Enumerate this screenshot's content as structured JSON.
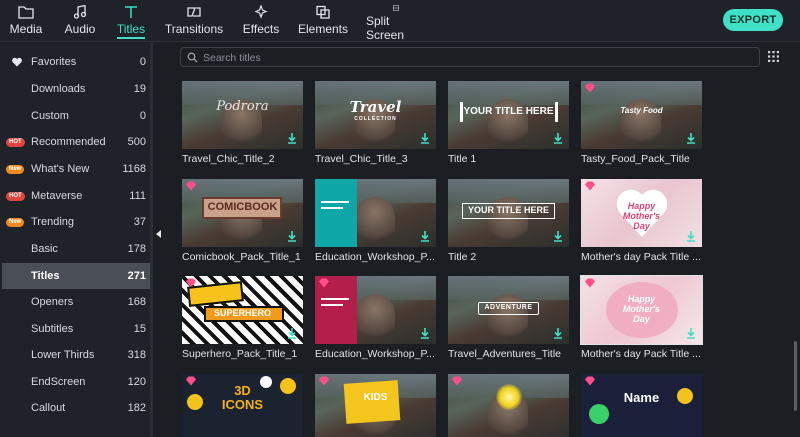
{
  "toolbar": {
    "tabs": [
      {
        "label": "Media",
        "icon": "folder-icon"
      },
      {
        "label": "Audio",
        "icon": "music-note-icon"
      },
      {
        "label": "Titles",
        "icon": "text-t-icon",
        "active": true
      },
      {
        "label": "Transitions",
        "icon": "transition-icon"
      },
      {
        "label": "Effects",
        "icon": "effects-sparkle-icon"
      },
      {
        "label": "Elements",
        "icon": "elements-icon"
      },
      {
        "label": "Split Screen",
        "icon": "split-screen-icon"
      }
    ],
    "export_label": "EXPORT"
  },
  "sidebar": {
    "items": [
      {
        "name": "Favorites",
        "count": "0",
        "icon": "heart-icon"
      },
      {
        "name": "Downloads",
        "count": "19"
      },
      {
        "name": "Custom",
        "count": "0"
      },
      {
        "name": "Recommended",
        "count": "500",
        "badge": "HOT"
      },
      {
        "name": "What's New",
        "count": "1168",
        "badge": "New"
      },
      {
        "name": "Metaverse",
        "count": "111",
        "badge": "HOT"
      },
      {
        "name": "Trending",
        "count": "37",
        "badge": "New"
      },
      {
        "name": "Basic",
        "count": "178"
      },
      {
        "name": "Titles",
        "count": "271",
        "active": true
      },
      {
        "name": "Openers",
        "count": "168"
      },
      {
        "name": "Subtitles",
        "count": "15"
      },
      {
        "name": "Lower Thirds",
        "count": "318"
      },
      {
        "name": "EndScreen",
        "count": "120"
      },
      {
        "name": "Callout",
        "count": "182"
      }
    ]
  },
  "search": {
    "placeholder": "Search titles"
  },
  "cards": [
    {
      "title": "Travel_Chic_Title_2",
      "overlay": "Podrora",
      "premium": false
    },
    {
      "title": "Travel_Chic_Title_3",
      "overlay": "Travel",
      "overlay_sub": "COLLECTION",
      "premium": false
    },
    {
      "title": "Title 1",
      "overlay": "YOUR TITLE HERE",
      "premium": false
    },
    {
      "title": "Tasty_Food_Pack_Title",
      "overlay": "Tasty Food",
      "premium": true
    },
    {
      "title": "Comicbook_Pack_Title_1",
      "overlay": "COMICBOOK",
      "premium": true
    },
    {
      "title": "Education_Workshop_P...",
      "overlay": "",
      "premium": false
    },
    {
      "title": "Title 2",
      "overlay": "YOUR TITLE HERE",
      "premium": false
    },
    {
      "title": "Mother's day Pack Title ...",
      "overlay": "Happy Mother's Day",
      "premium": true
    },
    {
      "title": "Superhero_Pack_Title_1",
      "overlay": "SUPERHERO",
      "premium": true
    },
    {
      "title": "Education_Workshop_P...",
      "overlay": "",
      "premium": true
    },
    {
      "title": "Travel_Adventures_Title",
      "overlay": "ADVENTURE",
      "premium": false
    },
    {
      "title": "Mother's day Pack Title ...",
      "overlay": "Happy Mother's Day",
      "premium": true
    },
    {
      "title": "",
      "overlay": "3D ICONS",
      "premium": true
    },
    {
      "title": "",
      "overlay": "KIDS",
      "premium": true
    },
    {
      "title": "",
      "overlay": "",
      "premium": true
    },
    {
      "title": "",
      "overlay": "Name",
      "premium": true
    }
  ],
  "colors": {
    "accent": "#3fe0c5",
    "hot_badge": "#e2453c",
    "new_badge": "#f08a1c",
    "premium_gem": "#ff4f8b"
  }
}
